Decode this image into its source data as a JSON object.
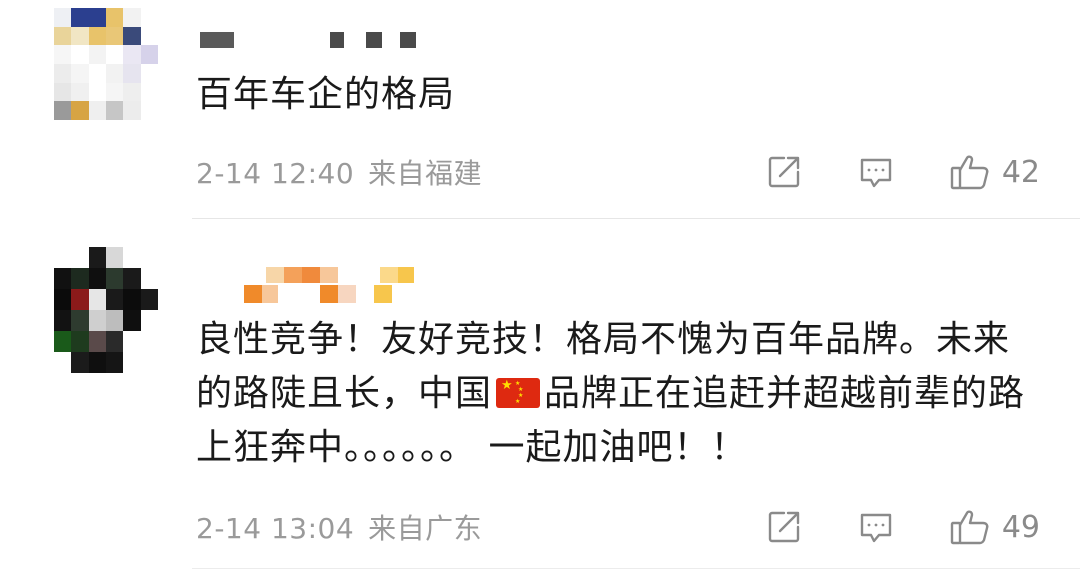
{
  "comments": [
    {
      "text": "百年车企的格局",
      "time": "2-14 12:40",
      "location": "来自福建",
      "likes": "42"
    },
    {
      "text_parts": [
        "良性竞争！友好竞技！格局不愧为百年品牌。未来的路陡且长，中国",
        "品牌正在追赶并超越前辈的路上狂奔中。。。。。。 一起加油吧！！"
      ],
      "time": "2-14 13:04",
      "location": "来自广东",
      "likes": "49"
    }
  ],
  "icons": {
    "repost": "repost-icon",
    "comment": "comment-icon",
    "like": "like-icon",
    "flag": "china-flag-icon"
  },
  "colors": {
    "meta_text": "#9a9a9a",
    "flag_red": "#de2910",
    "flag_star": "#ffde00"
  }
}
